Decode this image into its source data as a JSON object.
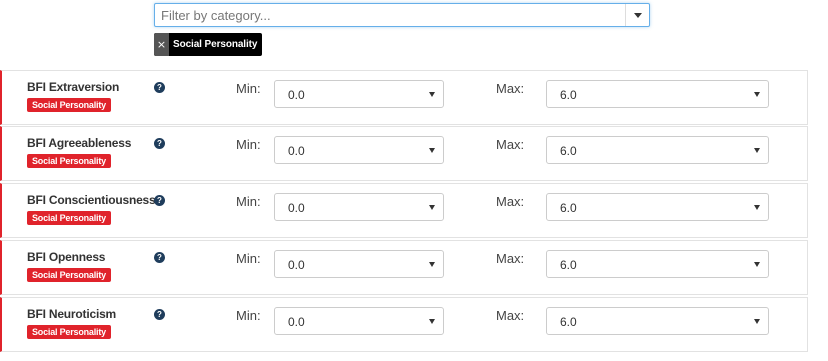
{
  "filter": {
    "placeholder": "Filter by category...",
    "selected_tags": [
      {
        "label": "Social Personality",
        "remove_symbol": "×"
      }
    ]
  },
  "labels": {
    "min": "Min:",
    "max": "Max:"
  },
  "help_symbol": "?",
  "accent_color": "#e0232b",
  "rows": [
    {
      "name": "BFI Extraversion",
      "category": "Social Personality",
      "min": "0.0",
      "max": "6.0"
    },
    {
      "name": "BFI Agreeableness",
      "category": "Social Personality",
      "min": "0.0",
      "max": "6.0"
    },
    {
      "name": "BFI Conscientiousness",
      "category": "Social Personality",
      "min": "0.0",
      "max": "6.0"
    },
    {
      "name": "BFI Openness",
      "category": "Social Personality",
      "min": "0.0",
      "max": "6.0"
    },
    {
      "name": "BFI Neuroticism",
      "category": "Social Personality",
      "min": "0.0",
      "max": "6.0"
    }
  ]
}
